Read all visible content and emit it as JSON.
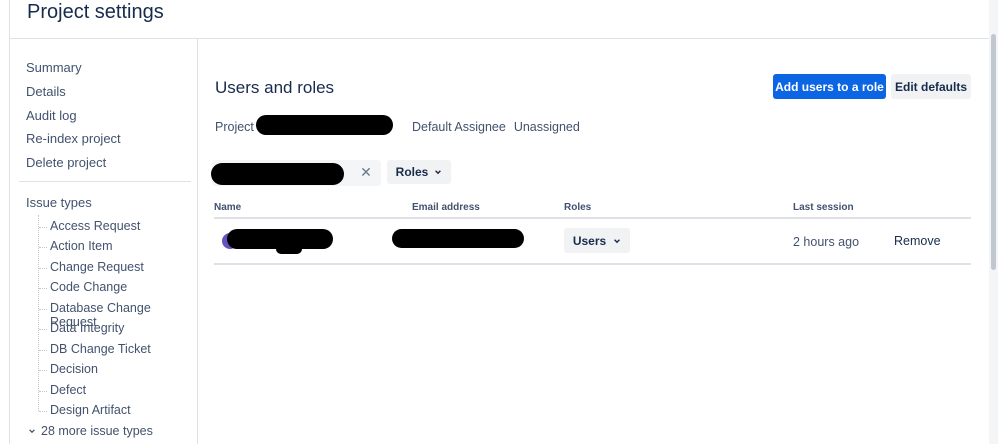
{
  "page": {
    "title": "Project settings"
  },
  "sidebar": {
    "links": [
      {
        "label": "Summary"
      },
      {
        "label": "Details"
      },
      {
        "label": "Audit log"
      },
      {
        "label": "Re-index project"
      },
      {
        "label": "Delete project"
      }
    ],
    "issue_types_label": "Issue types",
    "issue_types": [
      "Access Request",
      "Action Item",
      "Change Request",
      "Code Change",
      "Database Change Request",
      "Data Integrity",
      "DB Change Ticket",
      "Decision",
      "Defect",
      "Design Artifact"
    ],
    "more_label": "28 more issue types"
  },
  "main": {
    "section_title": "Users and roles",
    "add_users_label": "Add users to a role",
    "edit_defaults_label": "Edit defaults",
    "project_lead_label": "Project le",
    "default_assignee_label": "Default Assignee",
    "default_assignee_value": "Unassigned",
    "roles_filter_label": "Roles",
    "table": {
      "headers": [
        "Name",
        "Email address",
        "Roles",
        "Last session"
      ],
      "rows": [
        {
          "role": "Users",
          "last_session": "2 hours ago",
          "action": "Remove"
        }
      ]
    }
  },
  "icons": {
    "clear": "close-icon",
    "chevron": "chevron-down-icon"
  }
}
